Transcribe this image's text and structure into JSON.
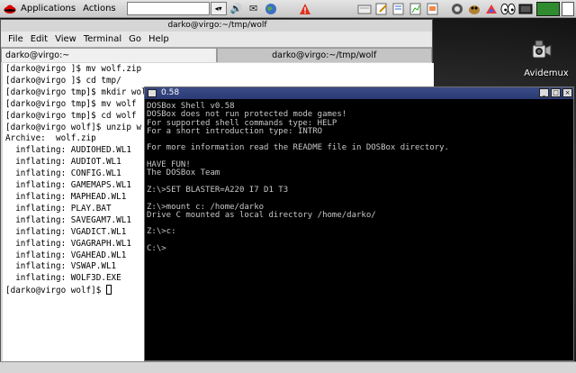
{
  "panel": {
    "applications": "Applications",
    "actions": "Actions"
  },
  "terminal": {
    "title": "darko@virgo:~/tmp/wolf",
    "menu": [
      "File",
      "Edit",
      "View",
      "Terminal",
      "Go",
      "Help"
    ],
    "tabs": [
      "darko@virgo:~",
      "darko@virgo:~/tmp/wolf"
    ],
    "lines": [
      "[darko@virgo ]$ mv wolf.zip tmp/",
      "[darko@virgo ]$ cd tmp/",
      "[darko@virgo tmp]$ mkdir wolf",
      "[darko@virgo tmp]$ mv wolf",
      "[darko@virgo tmp]$ cd wolf",
      "[darko@virgo wolf]$ unzip w",
      "Archive:  wolf.zip",
      "  inflating: AUDIOHED.WL1",
      "  inflating: AUDIOT.WL1",
      "  inflating: CONFIG.WL1",
      "  inflating: GAMEMAPS.WL1",
      "  inflating: MAPHEAD.WL1",
      "  inflating: PLAY.BAT",
      "  inflating: SAVEGAM7.WL1",
      "  inflating: VGADICT.WL1",
      "  inflating: VGAGRAPH.WL1",
      "  inflating: VGAHEAD.WL1",
      "  inflating: VSWAP.WL1",
      "  inflating: WOLF3D.EXE",
      "[darko@virgo wolf]$ "
    ]
  },
  "desktop": {
    "avidemux_label": "Avidemux"
  },
  "dosbox": {
    "title": "0.58",
    "lines": [
      "DOSBox Shell v0.58",
      "DOSBox does not run protected mode games!",
      "For supported shell commands type: HELP",
      "For a short introduction type: INTRO",
      "",
      "For more information read the README file in DOSBox directory.",
      "",
      "HAVE FUN!",
      "The DOSBox Team",
      "",
      "Z:\\>SET BLASTER=A220 I7 D1 T3",
      "",
      "Z:\\>mount c: /home/darko",
      "Drive C mounted as local directory /home/darko/",
      "",
      "Z:\\>c:",
      "",
      "C:\\>"
    ]
  },
  "colors": {
    "dos_title_bg": "#2a3a74",
    "panel_bg": "#d8d8d8",
    "pager_active": "#2e8b2e"
  }
}
